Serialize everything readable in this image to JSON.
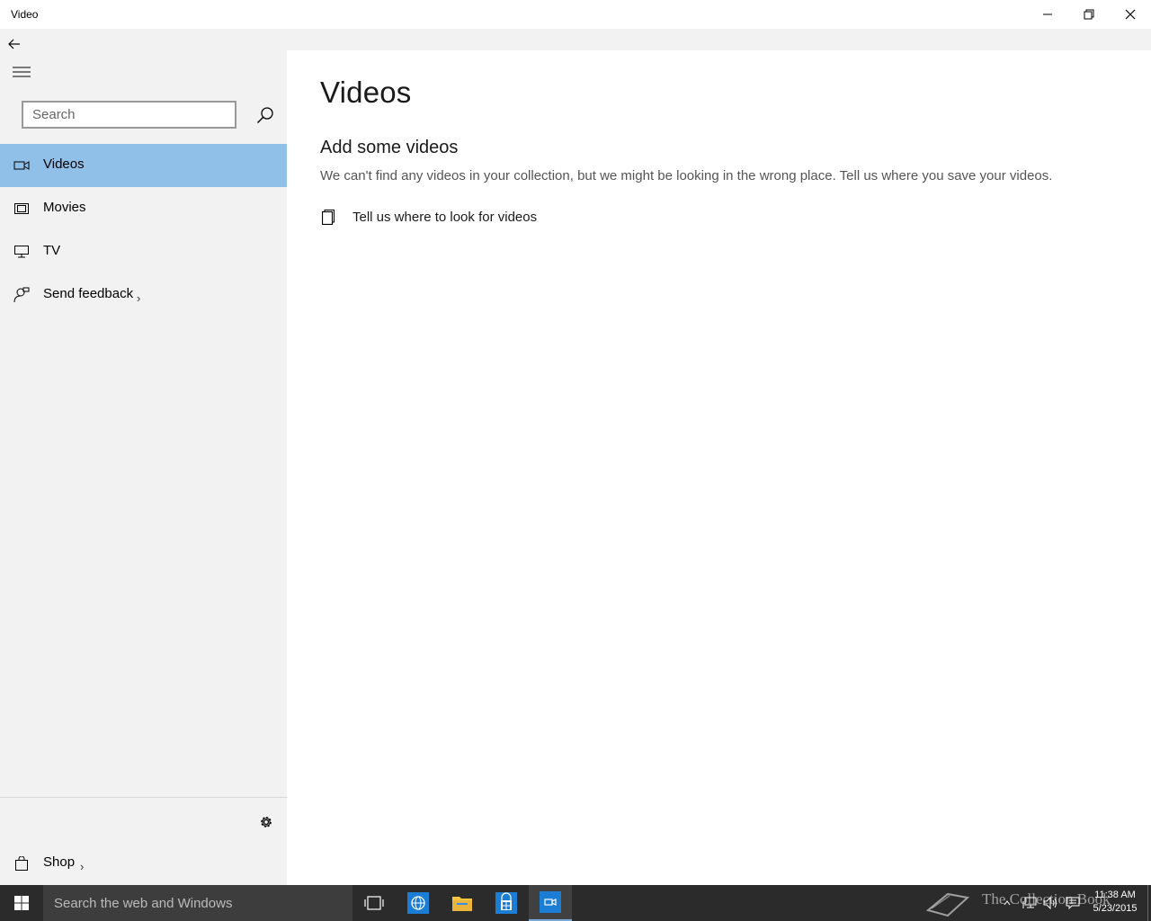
{
  "window": {
    "title": "Video",
    "minimize_label": "Minimize",
    "restore_label": "Restore",
    "close_label": "Close"
  },
  "sidebar": {
    "search_placeholder": "Search",
    "items": [
      {
        "label": "Videos",
        "icon": "video-camera-icon",
        "selected": true
      },
      {
        "label": "Movies",
        "icon": "film-icon",
        "selected": false
      },
      {
        "label": "TV",
        "icon": "monitor-icon",
        "selected": false
      },
      {
        "label": "Send feedback",
        "icon": "feedback-icon",
        "selected": false
      }
    ],
    "settings_icon": "gear-icon",
    "shop": {
      "label": "Shop",
      "icon": "shopping-bag-icon"
    }
  },
  "main": {
    "title": "Videos",
    "section_title": "Add some videos",
    "description": "We can't find any videos in your collection, but we might be looking in the wrong place. Tell us where you save your videos.",
    "link_label": "Tell us where to look for videos"
  },
  "taskbar": {
    "search_placeholder": "Search the web and Windows",
    "apps": [
      "task-view-icon",
      "internet-explorer-icon",
      "file-explorer-icon",
      "store-icon",
      "video-app-icon"
    ],
    "watermark": "The Collection Book",
    "time": "11:38 AM",
    "date": "5/23/2015"
  },
  "colors": {
    "selected_nav": "#90bfe7",
    "sidebar_bg": "#f2f2f2",
    "taskbar_bg": "#2b2b2b",
    "accent": "#0a6fc2"
  }
}
